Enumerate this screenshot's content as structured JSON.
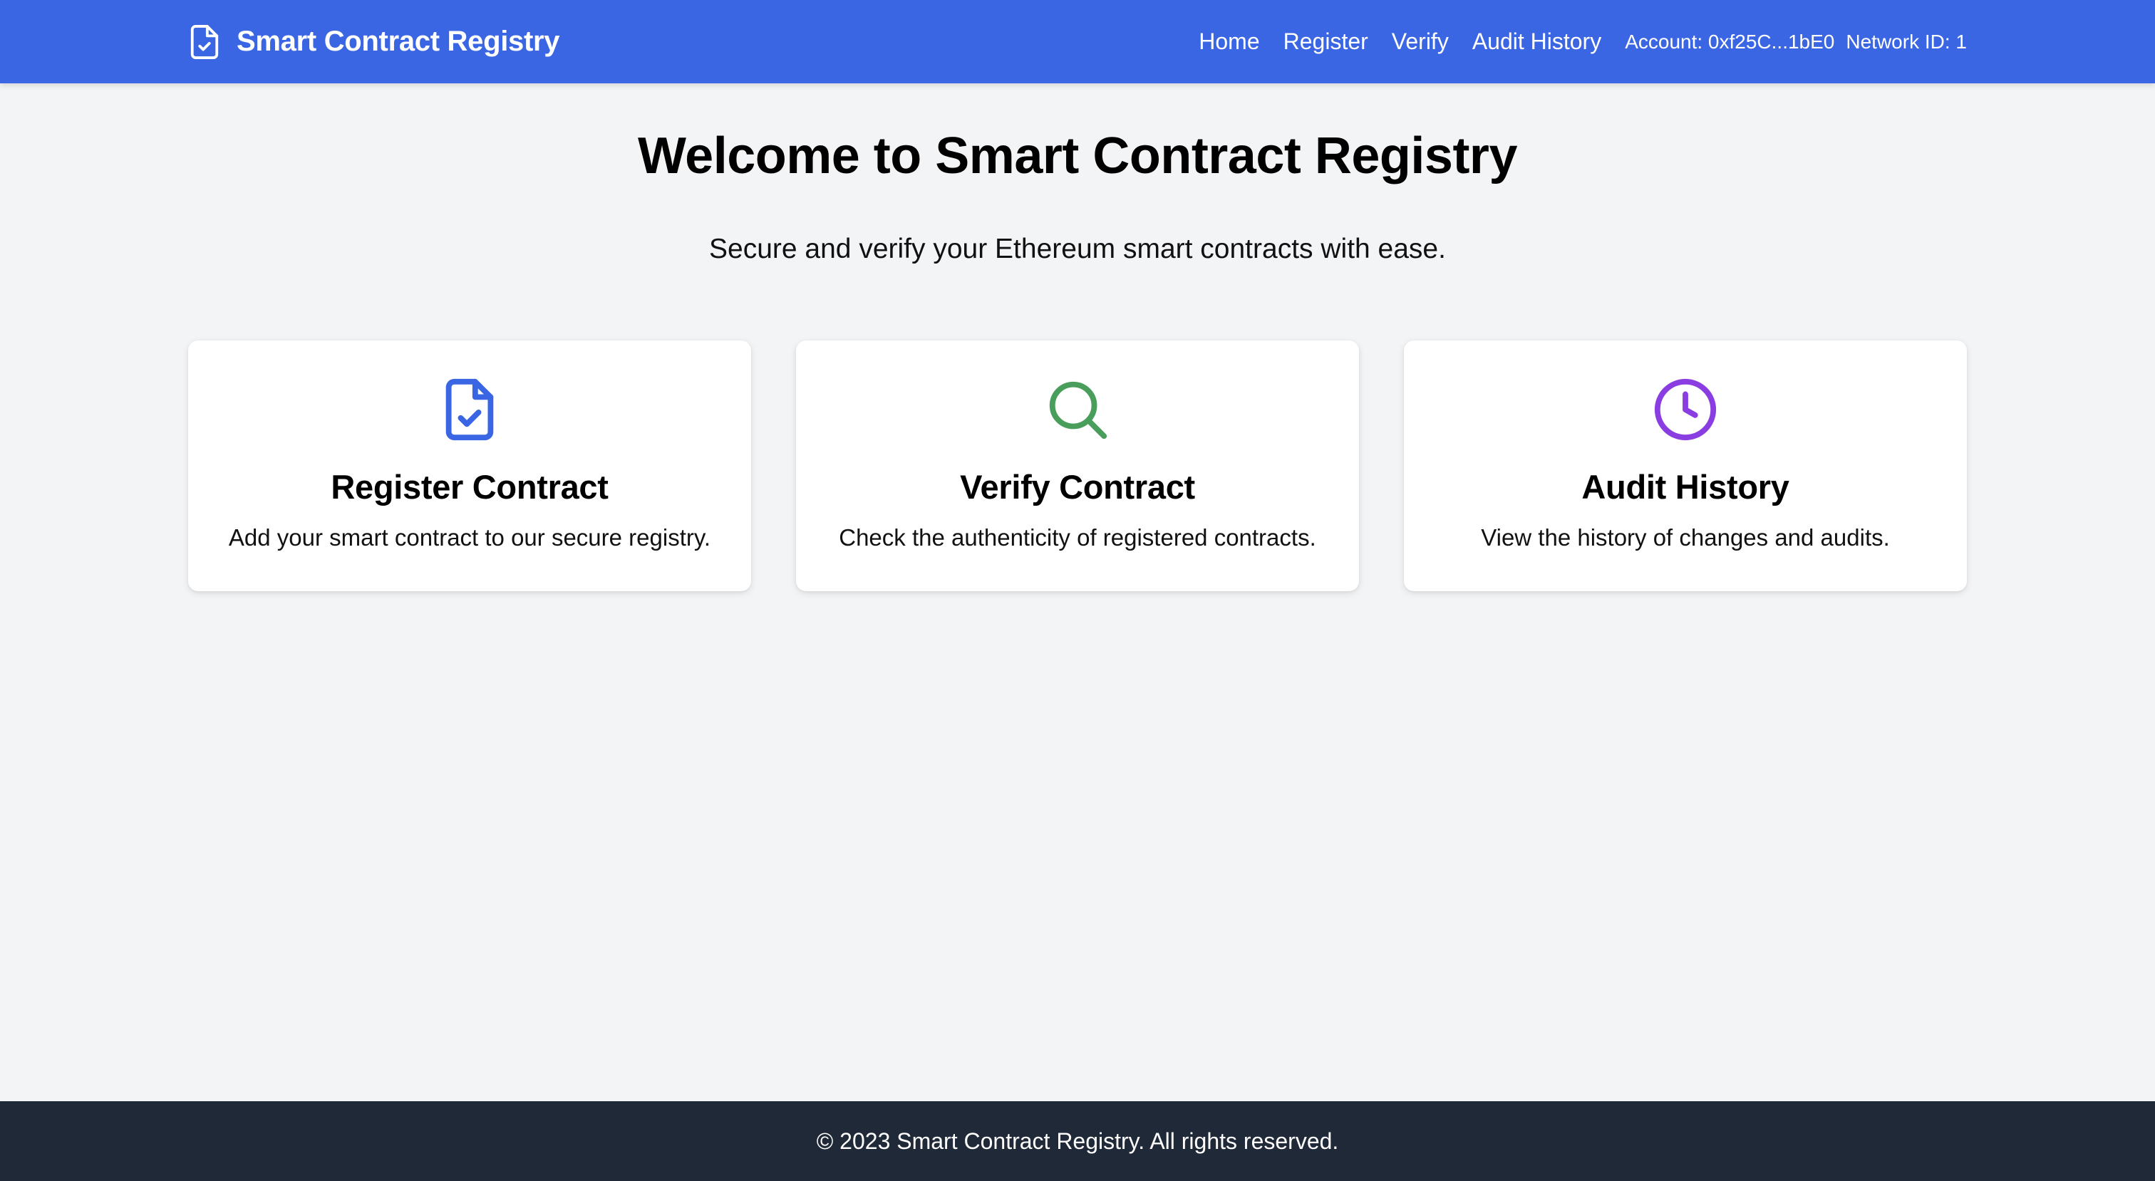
{
  "header": {
    "brand_title": "Smart Contract Registry",
    "brand_icon": "file-check-icon",
    "nav": [
      {
        "label": "Home"
      },
      {
        "label": "Register"
      },
      {
        "label": "Verify"
      },
      {
        "label": "Audit History"
      }
    ],
    "account": "Account: 0xf25C...1bE0",
    "network": "Network ID: 1",
    "bg_color": "#3b66e3"
  },
  "hero": {
    "title": "Welcome to Smart Contract Registry",
    "subtitle": "Secure and verify your Ethereum smart contracts with ease."
  },
  "cards": [
    {
      "icon": "file-check-icon",
      "icon_color": "#3b66e3",
      "title": "Register Contract",
      "description": "Add your smart contract to our secure registry."
    },
    {
      "icon": "search-icon",
      "icon_color": "#4a9e5c",
      "title": "Verify Contract",
      "description": "Check the authenticity of registered contracts."
    },
    {
      "icon": "clock-icon",
      "icon_color": "#8a3de0",
      "title": "Audit History",
      "description": "View the history of changes and audits."
    }
  ],
  "footer": {
    "text": "© 2023 Smart Contract Registry. All rights reserved.",
    "bg_color": "#202938"
  }
}
